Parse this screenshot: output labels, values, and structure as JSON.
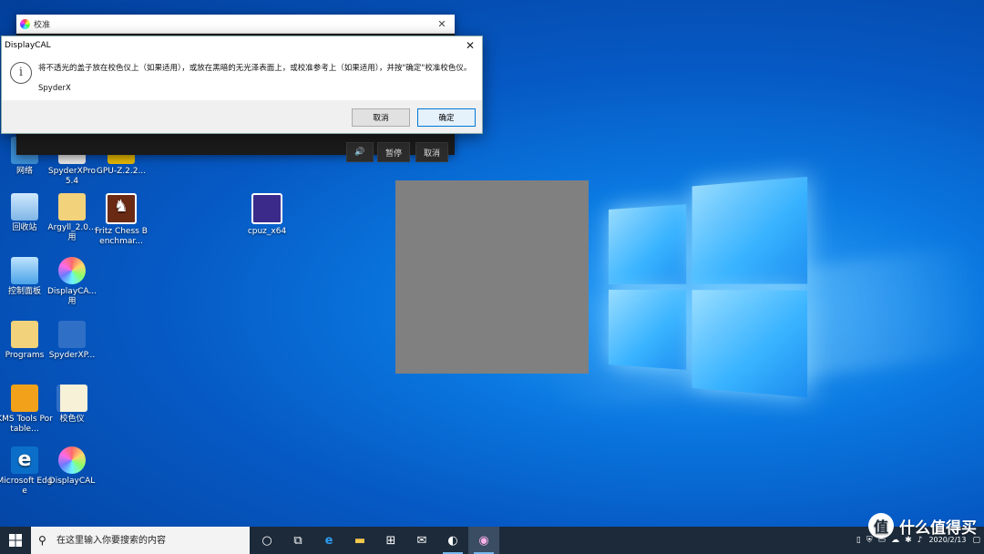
{
  "desktop_icons": [
    {
      "label": "网络",
      "x": 0,
      "y": 0
    },
    {
      "label": "SpyderXPro 5.4"
    },
    {
      "label": "GPU-Z.2.2..."
    },
    {
      "label": "回收站"
    },
    {
      "label": "Argyll_2.0...用"
    },
    {
      "label": "Fritz Chess Benchmar..."
    },
    {
      "label": "cpuz_x64"
    },
    {
      "label": "控制面板"
    },
    {
      "label": "DisplayCA...用"
    },
    {
      "label": "Programs"
    },
    {
      "label": "SpyderXP..."
    },
    {
      "label": "KMS Tools Portable..."
    },
    {
      "label": "校色仪"
    },
    {
      "label": "Microsoft Edge"
    },
    {
      "label": "DisplayCAL"
    }
  ],
  "calibration_window": {
    "title": "校准",
    "buttons": [
      "暂停",
      "取消"
    ]
  },
  "dialog": {
    "title": "DisplayCAL",
    "message": "将不透光的盖子放在校色仪上（如果适用），或放在黑暗的无光泽表面上，或校准参考上（如果适用），并按\"确定\"校准校色仪。",
    "device": "SpyderX",
    "cancel_label": "取消",
    "ok_label": "确定"
  },
  "taskbar": {
    "search_placeholder": "在这里输入你要搜索的内容",
    "date": "2020/2/13"
  },
  "watermark": "什么值得买",
  "colors": {
    "accent": "#0078d7",
    "taskbar": "#1c2a3a",
    "gray_patch": "#808080"
  }
}
